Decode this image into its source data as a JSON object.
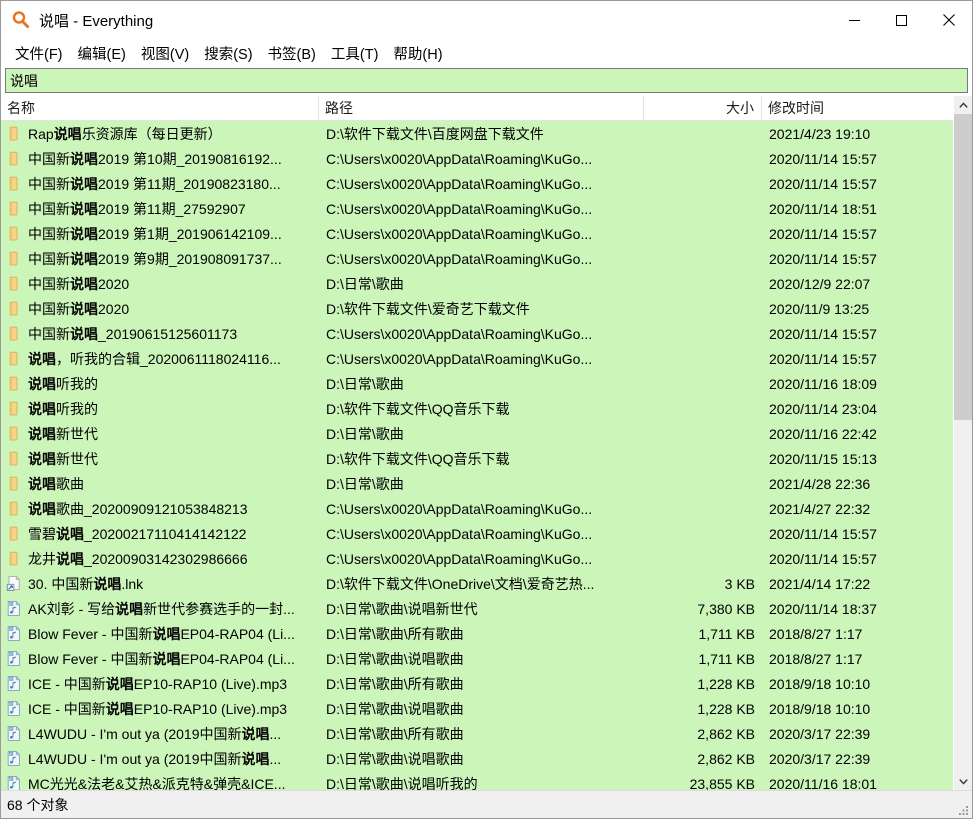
{
  "window": {
    "title": "说唱 - Everything",
    "app_icon": "search-magnifier-icon",
    "minimize_label": "最小化",
    "maximize_label": "最大化",
    "close_label": "关闭"
  },
  "menu": {
    "items": [
      {
        "label": "文件(F)",
        "name": "menu-file"
      },
      {
        "label": "编辑(E)",
        "name": "menu-edit"
      },
      {
        "label": "视图(V)",
        "name": "menu-view"
      },
      {
        "label": "搜索(S)",
        "name": "menu-search"
      },
      {
        "label": "书签(B)",
        "name": "menu-bookmark"
      },
      {
        "label": "工具(T)",
        "name": "menu-tools"
      },
      {
        "label": "帮助(H)",
        "name": "menu-help"
      }
    ]
  },
  "search": {
    "value": "说唱",
    "placeholder": ""
  },
  "columns": [
    {
      "key": "name",
      "label": "名称"
    },
    {
      "key": "path",
      "label": "路径"
    },
    {
      "key": "size",
      "label": "大小"
    },
    {
      "key": "date",
      "label": "修改时间"
    }
  ],
  "rows": [
    {
      "icon": "folder-icon",
      "name": "Rap说唱乐资源库（每日更新）",
      "bold": [
        "说唱"
      ],
      "path": "D:\\软件下载文件\\百度网盘下载文件",
      "size": "",
      "date": "2021/4/23 19:10"
    },
    {
      "icon": "folder-icon",
      "name": "中国新说唱2019 第10期_20190816192...",
      "bold": [
        "说唱"
      ],
      "path": "C:\\Users\\x0020\\AppData\\Roaming\\KuGo...",
      "size": "",
      "date": "2020/11/14 15:57"
    },
    {
      "icon": "folder-icon",
      "name": "中国新说唱2019 第11期_20190823180...",
      "bold": [
        "说唱"
      ],
      "path": "C:\\Users\\x0020\\AppData\\Roaming\\KuGo...",
      "size": "",
      "date": "2020/11/14 15:57"
    },
    {
      "icon": "folder-icon",
      "name": "中国新说唱2019 第11期_27592907",
      "bold": [
        "说唱"
      ],
      "path": "C:\\Users\\x0020\\AppData\\Roaming\\KuGo...",
      "size": "",
      "date": "2020/11/14 18:51"
    },
    {
      "icon": "folder-icon",
      "name": "中国新说唱2019 第1期_201906142109...",
      "bold": [
        "说唱"
      ],
      "path": "C:\\Users\\x0020\\AppData\\Roaming\\KuGo...",
      "size": "",
      "date": "2020/11/14 15:57"
    },
    {
      "icon": "folder-icon",
      "name": "中国新说唱2019 第9期_201908091737...",
      "bold": [
        "说唱"
      ],
      "path": "C:\\Users\\x0020\\AppData\\Roaming\\KuGo...",
      "size": "",
      "date": "2020/11/14 15:57"
    },
    {
      "icon": "folder-icon",
      "name": "中国新说唱2020",
      "bold": [
        "说唱"
      ],
      "path": "D:\\日常\\歌曲",
      "size": "",
      "date": "2020/12/9 22:07"
    },
    {
      "icon": "folder-icon",
      "name": "中国新说唱2020",
      "bold": [
        "说唱"
      ],
      "path": "D:\\软件下载文件\\爱奇艺下载文件",
      "size": "",
      "date": "2020/11/9 13:25"
    },
    {
      "icon": "folder-icon",
      "name": "中国新说唱_20190615125601173",
      "bold": [
        "说唱"
      ],
      "path": "C:\\Users\\x0020\\AppData\\Roaming\\KuGo...",
      "size": "",
      "date": "2020/11/14 15:57"
    },
    {
      "icon": "folder-icon",
      "name": "说唱，听我的合辑_2020061118024116...",
      "bold": [
        "说唱"
      ],
      "path": "C:\\Users\\x0020\\AppData\\Roaming\\KuGo...",
      "size": "",
      "date": "2020/11/14 15:57"
    },
    {
      "icon": "folder-icon",
      "name": "说唱听我的",
      "bold": [
        "说唱"
      ],
      "path": "D:\\日常\\歌曲",
      "size": "",
      "date": "2020/11/16 18:09"
    },
    {
      "icon": "folder-icon",
      "name": "说唱听我的",
      "bold": [
        "说唱"
      ],
      "path": "D:\\软件下载文件\\QQ音乐下载",
      "size": "",
      "date": "2020/11/14 23:04"
    },
    {
      "icon": "folder-icon",
      "name": "说唱新世代",
      "bold": [
        "说唱"
      ],
      "path": "D:\\日常\\歌曲",
      "size": "",
      "date": "2020/11/16 22:42"
    },
    {
      "icon": "folder-icon",
      "name": "说唱新世代",
      "bold": [
        "说唱"
      ],
      "path": "D:\\软件下载文件\\QQ音乐下载",
      "size": "",
      "date": "2020/11/15 15:13"
    },
    {
      "icon": "folder-icon",
      "name": "说唱歌曲",
      "bold": [
        "说唱"
      ],
      "path": "D:\\日常\\歌曲",
      "size": "",
      "date": "2021/4/28 22:36"
    },
    {
      "icon": "folder-icon",
      "name": "说唱歌曲_20200909121053848213",
      "bold": [
        "说唱"
      ],
      "path": "C:\\Users\\x0020\\AppData\\Roaming\\KuGo...",
      "size": "",
      "date": "2021/4/27 22:32"
    },
    {
      "icon": "folder-icon",
      "name": "雪碧说唱_20200217110414142122",
      "bold": [
        "说唱"
      ],
      "path": "C:\\Users\\x0020\\AppData\\Roaming\\KuGo...",
      "size": "",
      "date": "2020/11/14 15:57"
    },
    {
      "icon": "folder-icon",
      "name": "龙井说唱_20200903142302986666",
      "bold": [
        "说唱"
      ],
      "path": "C:\\Users\\x0020\\AppData\\Roaming\\KuGo...",
      "size": "",
      "date": "2020/11/14 15:57"
    },
    {
      "icon": "shortcut-icon",
      "name": "30. 中国新说唱.lnk",
      "bold": [
        "说唱"
      ],
      "path": "D:\\软件下载文件\\OneDrive\\文档\\爱奇艺热...",
      "size": "3 KB",
      "date": "2021/4/14 17:22"
    },
    {
      "icon": "mp3-icon",
      "name": "AK刘彰 - 写给说唱新世代参赛选手的一封...",
      "bold": [
        "说唱"
      ],
      "path": "D:\\日常\\歌曲\\说唱新世代",
      "size": "7,380 KB",
      "date": "2020/11/14 18:37"
    },
    {
      "icon": "mp3-icon",
      "name": "Blow Fever - 中国新说唱EP04-RAP04 (Li...",
      "bold": [
        "说唱"
      ],
      "path": "D:\\日常\\歌曲\\所有歌曲",
      "size": "1,711 KB",
      "date": "2018/8/27 1:17"
    },
    {
      "icon": "mp3-icon",
      "name": "Blow Fever - 中国新说唱EP04-RAP04 (Li...",
      "bold": [
        "说唱"
      ],
      "path": "D:\\日常\\歌曲\\说唱歌曲",
      "size": "1,711 KB",
      "date": "2018/8/27 1:17"
    },
    {
      "icon": "mp3-icon",
      "name": "ICE - 中国新说唱EP10-RAP10 (Live).mp3",
      "bold": [
        "说唱"
      ],
      "path": "D:\\日常\\歌曲\\所有歌曲",
      "size": "1,228 KB",
      "date": "2018/9/18 10:10"
    },
    {
      "icon": "mp3-icon",
      "name": "ICE - 中国新说唱EP10-RAP10 (Live).mp3",
      "bold": [
        "说唱"
      ],
      "path": "D:\\日常\\歌曲\\说唱歌曲",
      "size": "1,228 KB",
      "date": "2018/9/18 10:10"
    },
    {
      "icon": "mp3-icon",
      "name": "L4WUDU - I'm out ya (2019中国新说唱...",
      "bold": [
        "说唱"
      ],
      "path": "D:\\日常\\歌曲\\所有歌曲",
      "size": "2,862 KB",
      "date": "2020/3/17 22:39"
    },
    {
      "icon": "mp3-icon",
      "name": "L4WUDU - I'm out ya (2019中国新说唱...",
      "bold": [
        "说唱"
      ],
      "path": "D:\\日常\\歌曲\\说唱歌曲",
      "size": "2,862 KB",
      "date": "2020/3/17 22:39"
    },
    {
      "icon": "mp3-icon",
      "name": "MC光光&法老&艾热&派克特&弹壳&ICE...",
      "bold": [],
      "path": "D:\\日常\\歌曲\\说唱听我的",
      "size": "23,855 KB",
      "date": "2020/11/16 18:01"
    }
  ],
  "status": {
    "text": "68 个对象"
  },
  "scrollbar": {
    "up_label": "向上滚动",
    "down_label": "向下滚动",
    "thumb_label": "滚动条滑块"
  },
  "colors": {
    "row_background": "#ccf5ba",
    "folder_icon": "#f5cf7a",
    "accent": "#e8741e",
    "header_background": "#ffffff",
    "statusbar_background": "#f0f0f0"
  }
}
